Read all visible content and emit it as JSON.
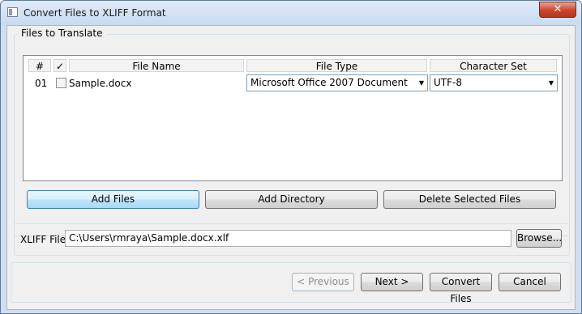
{
  "window": {
    "title": "Convert Files to XLIFF Format",
    "close_glyph": "✕"
  },
  "files_group": {
    "label": "Files to Translate",
    "columns": {
      "num": "#",
      "check": "✓",
      "file_name": "File Name",
      "file_type": "File Type",
      "charset": "Character Set"
    },
    "rows": [
      {
        "num": "01",
        "checked": false,
        "file_name": "Sample.docx",
        "file_type": "Microsoft Office 2007 Document",
        "charset": "UTF-8"
      }
    ],
    "combo_arrow": "▼"
  },
  "buttons": {
    "add_files": "Add Files",
    "add_directory": "Add Directory",
    "delete_selected": "Delete Selected Files"
  },
  "xliff": {
    "label": "XLIFF File",
    "value": "C:\\Users\\rmraya\\Sample.docx.xlf",
    "browse": "Browse..."
  },
  "footer": {
    "previous": "< Previous",
    "next": "Next >",
    "convert": "Convert Files",
    "cancel": "Cancel"
  }
}
